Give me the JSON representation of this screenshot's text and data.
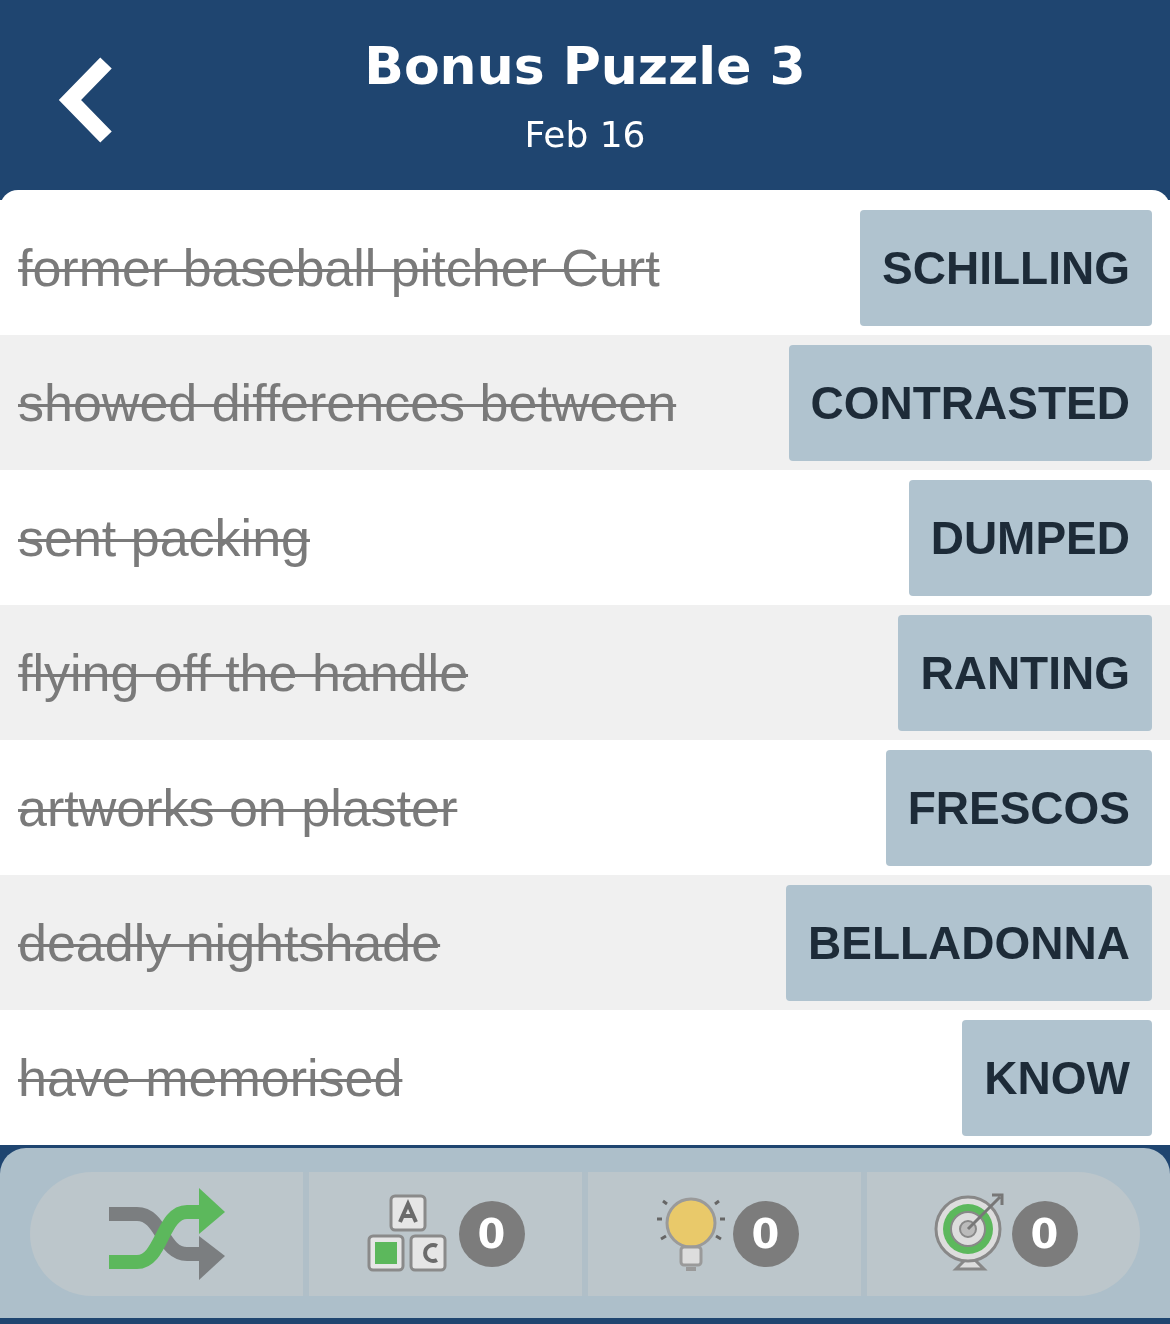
{
  "header": {
    "title": "Bonus Puzzle 3",
    "subtitle": "Feb 16"
  },
  "clues": [
    {
      "clue": "former baseball pitcher Curt",
      "answer": "SCHILLING",
      "solved": true
    },
    {
      "clue": "showed differences between",
      "answer": "CONTRASTED",
      "solved": true
    },
    {
      "clue": "sent packing",
      "answer": "DUMPED",
      "solved": true
    },
    {
      "clue": "flying off the handle",
      "answer": "RANTING",
      "solved": true
    },
    {
      "clue": "artworks on plaster",
      "answer": "FRESCOS",
      "solved": true
    },
    {
      "clue": "deadly nightshade",
      "answer": "BELLADONNA",
      "solved": true
    },
    {
      "clue": "have memorised",
      "answer": "KNOW",
      "solved": true
    }
  ],
  "tools": [
    {
      "kind": "shuffle"
    },
    {
      "kind": "letters",
      "count": "0"
    },
    {
      "kind": "hint",
      "count": "0"
    },
    {
      "kind": "target",
      "count": "0"
    }
  ]
}
